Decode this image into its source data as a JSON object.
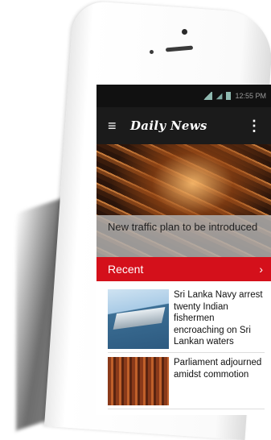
{
  "status_bar": {
    "time": "12:55 PM"
  },
  "app_bar": {
    "logo": "Daily News"
  },
  "hero": {
    "headline": "New traffic plan to be introduced"
  },
  "section": {
    "title": "Recent"
  },
  "news": [
    {
      "headline": "Sri Lanka Navy arrest twenty Indian fishermen encroaching on Sri Lankan waters"
    },
    {
      "headline": "Parliament adjourned amidst commotion"
    }
  ]
}
